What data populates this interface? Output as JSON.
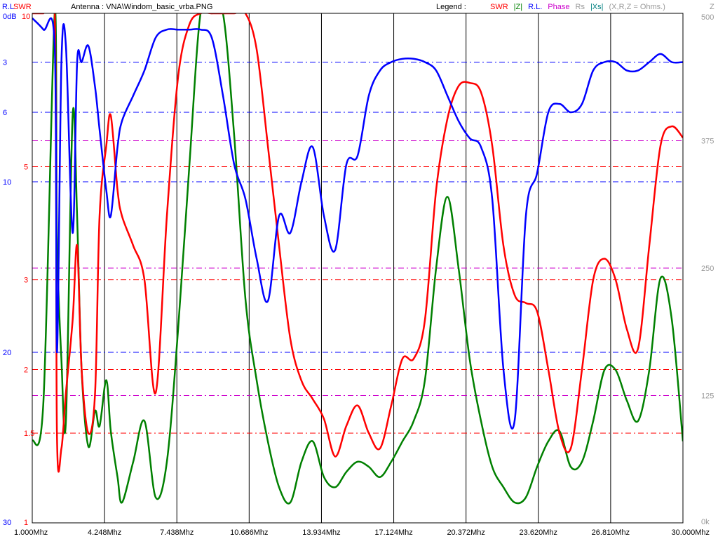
{
  "header": {
    "rl_label": "R.L",
    "swr_label": "SWR",
    "antenna_text": "Antenna : VNA\\Windom_basic_vrba.PNG",
    "legend_label": "Legend :",
    "legend_items": [
      {
        "text": "SWR",
        "color": "#ff0000"
      },
      {
        "text": "|Z|",
        "color": "#008000"
      },
      {
        "text": "R.L.",
        "color": "#0000ff"
      },
      {
        "text": "Phase",
        "color": "#cc00cc"
      },
      {
        "text": "Rs",
        "color": "#999999"
      },
      {
        "text": "|Xs|",
        "color": "#008080"
      },
      {
        "text": "(X,R,Z = Ohms.)",
        "color": "#999999"
      }
    ],
    "z_label": "Z"
  },
  "colors": {
    "swr": "#ff0000",
    "z": "#008000",
    "rl": "#0000ff",
    "phase": "#cc00cc",
    "grid": "#000000",
    "frame": "#000000",
    "bg": "#ffffff"
  },
  "chart_data": {
    "type": "line",
    "x": [
      1.0,
      1.5,
      2.0,
      2.1,
      2.3,
      2.5,
      2.8,
      3.0,
      3.2,
      3.5,
      3.8,
      4.0,
      4.3,
      4.5,
      4.8,
      5.0,
      5.5,
      6.0,
      6.5,
      7.0,
      7.5,
      8.0,
      8.5,
      9.0,
      9.5,
      10.0,
      10.5,
      11.0,
      11.5,
      12.0,
      12.5,
      13.0,
      13.5,
      14.0,
      14.5,
      15.0,
      15.5,
      16.0,
      16.5,
      17.0,
      17.5,
      18.0,
      18.5,
      19.0,
      19.5,
      20.0,
      20.5,
      21.0,
      21.5,
      22.0,
      22.5,
      23.0,
      23.5,
      24.0,
      24.5,
      25.0,
      25.5,
      26.0,
      26.5,
      27.0,
      27.5,
      28.0,
      28.5,
      29.0,
      29.5,
      30.0
    ],
    "series": [
      {
        "name": "SWR",
        "color": "#ff0000",
        "values": [
          10,
          10,
          10,
          1.5,
          1.4,
          1.8,
          2.5,
          3.5,
          2.0,
          1.5,
          1.8,
          4.0,
          5.5,
          6.3,
          4.5,
          4.0,
          3.5,
          3.0,
          1.8,
          4.0,
          7.5,
          9.5,
          10,
          10,
          10,
          10,
          10,
          8.5,
          5.5,
          3.5,
          2.3,
          1.9,
          1.75,
          1.6,
          1.35,
          1.55,
          1.7,
          1.5,
          1.4,
          1.7,
          2.1,
          2.1,
          2.5,
          4.5,
          6.2,
          7.2,
          7.3,
          7.0,
          5.5,
          3.5,
          2.8,
          2.7,
          2.6,
          2.0,
          1.5,
          1.4,
          2.0,
          3.0,
          3.3,
          3.0,
          2.4,
          2.2,
          3.5,
          5.5,
          6.0,
          5.7
        ]
      },
      {
        "name": "|Z|",
        "color": "#008000",
        "values": [
          80,
          120,
          500,
          280,
          160,
          100,
          400,
          300,
          150,
          75,
          110,
          95,
          140,
          90,
          45,
          20,
          60,
          100,
          25,
          60,
          190,
          350,
          500,
          500,
          500,
          380,
          220,
          140,
          80,
          35,
          20,
          60,
          80,
          45,
          35,
          50,
          60,
          55,
          45,
          60,
          80,
          100,
          140,
          250,
          320,
          250,
          160,
          100,
          55,
          35,
          20,
          25,
          55,
          80,
          90,
          55,
          60,
          100,
          150,
          150,
          120,
          100,
          150,
          240,
          200,
          80
        ]
      },
      {
        "name": "R.L.",
        "color": "#0000ff",
        "values": [
          0.3,
          1.0,
          2.0,
          20,
          3.0,
          2.0,
          13.0,
          3.0,
          3.0,
          2.0,
          4.5,
          7.0,
          10.5,
          12.0,
          8.0,
          6.5,
          5.0,
          3.5,
          1.5,
          1.0,
          1.0,
          1.0,
          1.0,
          1.5,
          5.0,
          9.0,
          11.0,
          14.5,
          17.0,
          12.0,
          13.0,
          10.0,
          8.0,
          12.0,
          14.0,
          9.0,
          8.5,
          5.0,
          3.5,
          3.0,
          2.8,
          2.8,
          3.0,
          3.5,
          5.0,
          6.5,
          7.5,
          8.0,
          11.0,
          21.0,
          24.0,
          12.0,
          9.5,
          6.0,
          5.5,
          6.0,
          5.5,
          3.5,
          3.0,
          3.0,
          3.5,
          3.5,
          3.0,
          2.5,
          3.0,
          3.0
        ]
      }
    ],
    "left_axis_rl": {
      "label": "R.L",
      "unit": "dB",
      "range": [
        0,
        30
      ],
      "ticks": [
        "0dB",
        "3",
        "6",
        "10",
        "20",
        "30"
      ]
    },
    "left_axis_swr": {
      "label": "SWR",
      "range": [
        1,
        10
      ],
      "ticks": [
        "10",
        "5",
        "3",
        "2",
        "1.5",
        "1"
      ]
    },
    "right_axis_z": {
      "label": "Z",
      "range": [
        0,
        500
      ],
      "ticks": [
        "500",
        "375",
        "250",
        "125",
        "0k"
      ]
    },
    "x_ticks": [
      "1.000Mhz",
      "4.248Mhz",
      "7.438Mhz",
      "10.686Mhz",
      "13.934Mhz",
      "17.124Mhz",
      "20.372Mhz",
      "23.620Mhz",
      "26.810Mhz",
      "30.000Mhz"
    ],
    "xlim": [
      1.0,
      30.0
    ],
    "grid": true,
    "legend": "top-right"
  }
}
